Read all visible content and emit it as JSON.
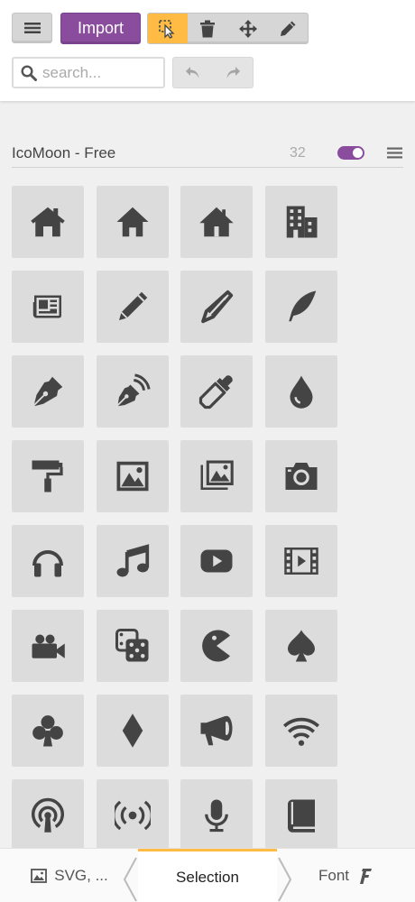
{
  "toolbar": {
    "import_label": "Import",
    "search_placeholder": "search..."
  },
  "icon_set": {
    "title": "IcoMoon - Free",
    "count": "32"
  },
  "icons": [
    "home-icon",
    "home2-icon",
    "home3-icon",
    "office-icon",
    "newspaper-icon",
    "pencil-icon",
    "pencil2-icon",
    "quill-icon",
    "pen-icon",
    "blog-icon",
    "eyedropper-icon",
    "droplet-icon",
    "paint-format-icon",
    "image-icon",
    "images-icon",
    "camera-icon",
    "headphones-icon",
    "music-icon",
    "play-icon",
    "film-icon",
    "video-camera-icon",
    "dice-icon",
    "pacman-icon",
    "spades-icon",
    "clubs-icon",
    "diamonds-icon",
    "bullhorn-icon",
    "connection-icon",
    "podcast-icon",
    "feed-icon",
    "mic-icon",
    "book-icon"
  ],
  "tabs": {
    "svg_label": "SVG, ...",
    "selection_label": "Selection",
    "font_label": "Font"
  },
  "colors": {
    "accent_purple": "#8a4d9e",
    "selected_orange": "#ffbb44",
    "icon_color": "#444444"
  }
}
